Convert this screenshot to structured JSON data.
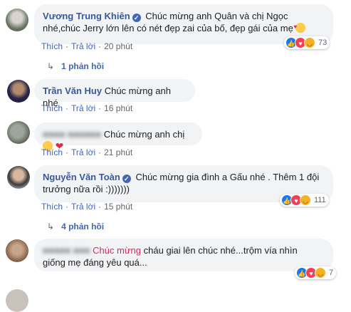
{
  "comments": [
    {
      "author": "Vương Trung Khiên",
      "verified": true,
      "text_line1": "Chúc mừng anh Quân và chị Ngọc",
      "text_line2": "nhé,chúc Jerry lớn lên có nét đẹp zai của bố, đẹp gái của mẹ",
      "emoji": "smiling-face-with-hearts",
      "actions": {
        "like": "Thích",
        "reply": "Trả lời",
        "time": "20 phút"
      },
      "reaction_count": "73",
      "reactions": [
        "like",
        "love",
        "haha"
      ],
      "replies_label": "1 phản hồi"
    },
    {
      "author": "Trần Văn Huy",
      "verified": false,
      "text": "Chúc mừng anh nhé",
      "actions": {
        "like": "Thích",
        "reply": "Trả lời",
        "time": "16 phút"
      }
    },
    {
      "author_hidden": true,
      "text": "Chúc mừng anh chị",
      "emojis": [
        "smiling-face",
        "red-heart"
      ],
      "actions": {
        "like": "Thích",
        "reply": "Trả lời",
        "time": "21 phút"
      }
    },
    {
      "author": "Nguyễn Văn Toàn",
      "verified": true,
      "text_line1": "Chúc mừng gia đình a Gấu nhé . Thêm 1 đội",
      "text_line2": "trưởng nữa rồi :)))))))",
      "actions": {
        "like": "Thích",
        "reply": "Trả lời",
        "time": "15 phút"
      },
      "reaction_count": "111",
      "reactions": [
        "like",
        "love",
        "haha"
      ],
      "replies_label": "4 phản hồi"
    },
    {
      "author_hidden": true,
      "highlight": "Chúc mừng",
      "text_line1_rest": "cháu giai lên chúc nhé...trộm vía nhìn",
      "text_line2": "giống mẹ đáng yêu quá...",
      "reaction_count": "7",
      "reactions": [
        "like",
        "love",
        "haha"
      ]
    }
  ],
  "colors": {
    "link": "#385898",
    "action": "#4267b2",
    "bubble": "#f2f3f5",
    "highlight": "#e0245e"
  }
}
